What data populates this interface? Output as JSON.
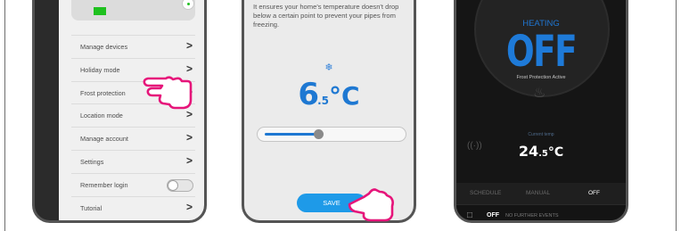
{
  "phone1": {
    "menu": [
      {
        "label": "Manage devices",
        "control": "chevron"
      },
      {
        "label": "Holiday mode",
        "control": "chevron"
      },
      {
        "label": "Frost protection",
        "control": "chevron"
      },
      {
        "label": "Location mode",
        "control": "chevron"
      },
      {
        "label": "Manage account",
        "control": "chevron"
      },
      {
        "label": "Settings",
        "control": "chevron"
      },
      {
        "label": "Remember login",
        "control": "toggle"
      },
      {
        "label": "Tutorial",
        "control": "chevron"
      }
    ],
    "chevron_glyph": ">",
    "icons": [
      "green-status-indicator",
      "pointing-hand-icon"
    ]
  },
  "phone2": {
    "description": "It ensures your home's temperature doesn't drop below a certain point to prevent your pipes from freezing.",
    "snow_icon": "❄",
    "temperature": {
      "whole": "6",
      "decimal": ".5",
      "unit": "°C"
    },
    "slider_level": 0.4,
    "save_label": "SAVE"
  },
  "phone3": {
    "heating_label": "HEATING",
    "state": "OFF",
    "status": "Frost Protection Active",
    "current_temp_label": "Current temp",
    "current_temp": {
      "whole": "24",
      "decimal": ".5",
      "unit": "°C"
    },
    "tabs": [
      "SCHEDULE",
      "MANUAL",
      "OFF"
    ],
    "active_tab": "OFF",
    "bottom_state": "OFF",
    "bottom_events": "NO FURTHER EVENTS"
  },
  "colors": {
    "accent": "#1e78d2",
    "hand": "#e6157a",
    "green": "#1fc11f"
  }
}
